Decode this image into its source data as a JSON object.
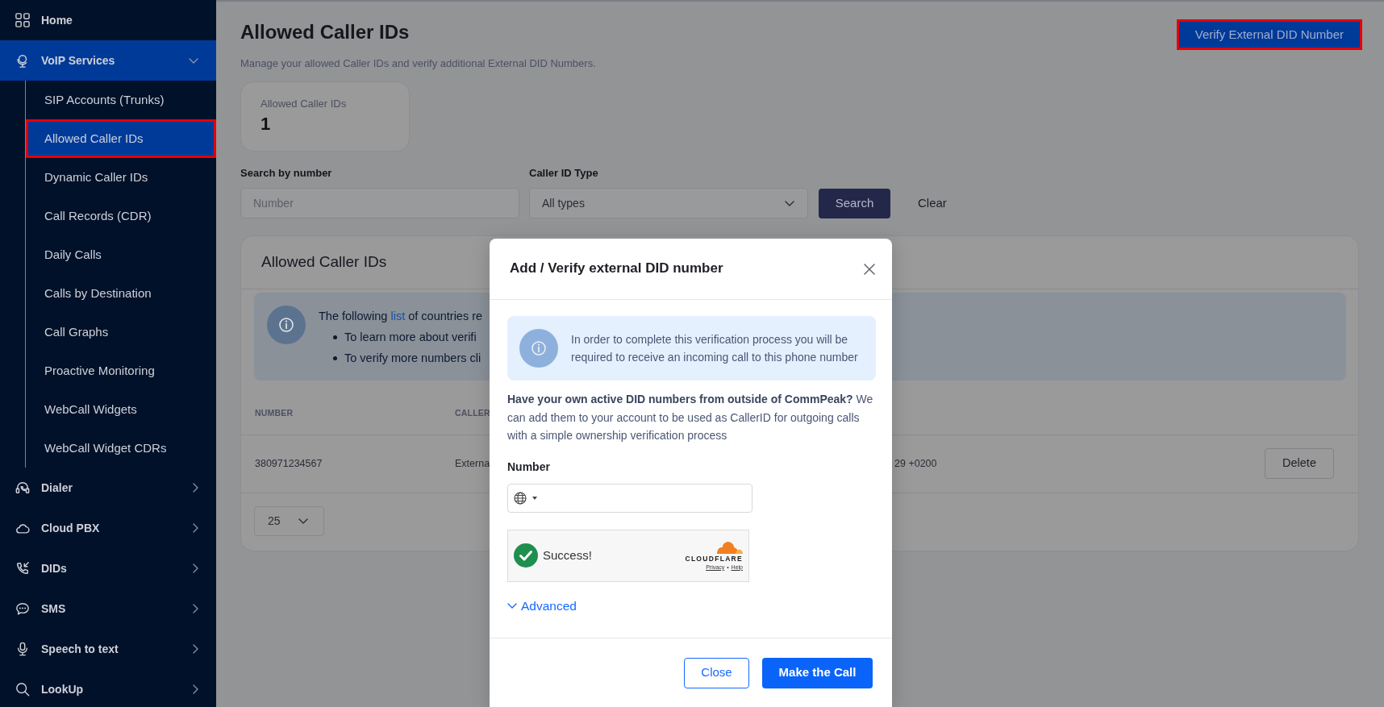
{
  "sidebar": {
    "items": [
      {
        "label": "Home",
        "kind": "link",
        "selected": false
      },
      {
        "label": "VoIP Services",
        "kind": "group",
        "selected": true,
        "expanded": true,
        "children": [
          {
            "label": "SIP Accounts (Trunks)",
            "selected": false,
            "highlighted": false
          },
          {
            "label": "Allowed Caller IDs",
            "selected": true,
            "highlighted": true
          },
          {
            "label": "Dynamic Caller IDs",
            "selected": false,
            "highlighted": false
          },
          {
            "label": "Call Records (CDR)",
            "selected": false,
            "highlighted": false
          },
          {
            "label": "Daily Calls",
            "selected": false,
            "highlighted": false
          },
          {
            "label": "Calls by Destination",
            "selected": false,
            "highlighted": false
          },
          {
            "label": "Call Graphs",
            "selected": false,
            "highlighted": false
          },
          {
            "label": "Proactive Monitoring",
            "selected": false,
            "highlighted": false
          },
          {
            "label": "WebCall Widgets",
            "selected": false,
            "highlighted": false
          },
          {
            "label": "WebCall Widget CDRs",
            "selected": false,
            "highlighted": false
          }
        ]
      },
      {
        "label": "Dialer",
        "kind": "group",
        "selected": false,
        "expanded": false
      },
      {
        "label": "Cloud PBX",
        "kind": "group",
        "selected": false,
        "expanded": false
      },
      {
        "label": "DIDs",
        "kind": "group",
        "selected": false,
        "expanded": false
      },
      {
        "label": "SMS",
        "kind": "group",
        "selected": false,
        "expanded": false
      },
      {
        "label": "Speech to text",
        "kind": "group",
        "selected": false,
        "expanded": false
      },
      {
        "label": "LookUp",
        "kind": "group",
        "selected": false,
        "expanded": false
      }
    ]
  },
  "header": {
    "title": "Allowed Caller IDs",
    "subtitle": "Manage your allowed Caller IDs and verify additional External DID Numbers.",
    "action_button": {
      "label": "Verify External DID Number",
      "highlighted": true
    }
  },
  "stat_card": {
    "label": "Allowed Caller IDs",
    "value": "1"
  },
  "filters": {
    "number_field": {
      "label": "Search by number",
      "placeholder": "Number"
    },
    "type_select": {
      "label": "Caller ID Type",
      "value": "All types"
    },
    "buttons": [
      {
        "label": "Search",
        "kind": "primary"
      },
      {
        "label": "Clear",
        "kind": "link"
      }
    ]
  },
  "table_card": {
    "title": "Allowed Caller IDs",
    "notice": {
      "text_before": "The following",
      "link": "list",
      "text_after": "of countries re",
      "bullets": [
        "To learn more about verifi",
        "To verify more numbers cli"
      ]
    },
    "table": {
      "columns": [
        "NUMBER",
        "CALLER"
      ],
      "rows": [
        {
          "cells": [
            "380971234567",
            "Externa",
            "29 +0200"
          ],
          "action": "Delete"
        }
      ]
    },
    "page_size": "25"
  },
  "modal": {
    "title": "Add / Verify external DID number",
    "notice": "In order to complete this verification process you will be required to receive an incoming call to this phone number",
    "intro": "**Have your own active DID numbers from outside of CommPeak?** We can add them to your account to be used as CallerID for outgoing calls with a simple ownership verification process",
    "number_field": {
      "label": "Number"
    },
    "captcha": {
      "verified": true,
      "status": "Success!",
      "brand": "CLOUDFLARE",
      "links": [
        "Privacy",
        "Help"
      ],
      "separator": "•"
    },
    "advanced_link": {
      "label": "Advanced",
      "expanded": false
    },
    "buttons": [
      {
        "label": "Close",
        "kind": "outline"
      },
      {
        "label": "Make the Call",
        "kind": "primary"
      }
    ]
  }
}
